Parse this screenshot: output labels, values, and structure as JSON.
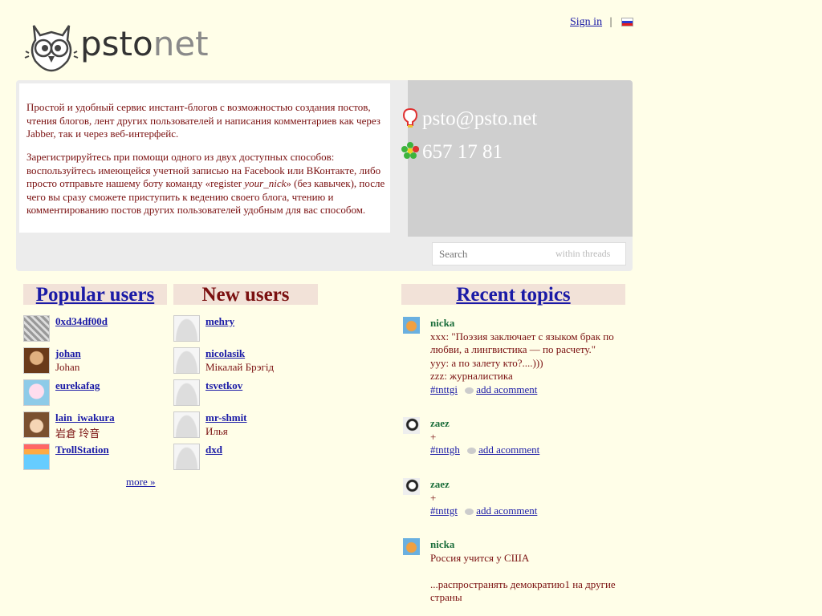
{
  "header": {
    "sign_in": "Sign in",
    "separator": "|",
    "logo_text_a": "psto",
    "logo_text_b": "net"
  },
  "intro": {
    "p1": "Простой и удобный сервис инстант-блогов с возможностью создания постов, чтения блогов, лент других пользователей и написания комментариев как через Jabber, так и через веб-интерфейс.",
    "p2_a": "Зарегистрируйтесь при помощи одного из двух доступных способов: воспользуйтесь имеющейся учетной записью на Facebook или ВКонтакте, либо просто отправьте нашему боту команду «register ",
    "p2_nick": "your_nick",
    "p2_b": "» (без кавычек), после чего вы сразу сможете приступить к ведению своего блога, чтению и комментированию постов других пользователей удобным для вас способом."
  },
  "contact": {
    "jabber": "psto@psto.net",
    "icq": "657 17 81"
  },
  "search": {
    "placeholder": "Search",
    "within": "within threads"
  },
  "columns": {
    "popular": "Popular users",
    "new": "New users",
    "recent": "Recent topics"
  },
  "popular_users": [
    {
      "nick": "0xd34df00d",
      "name": ""
    },
    {
      "nick": "johan",
      "name": "Johan"
    },
    {
      "nick": "eurekafag",
      "name": ""
    },
    {
      "nick": "lain_iwakura",
      "name": "岩倉 玲音"
    },
    {
      "nick": "TrollStation",
      "name": ""
    }
  ],
  "more": "more »",
  "new_users": [
    {
      "nick": "mehry",
      "name": ""
    },
    {
      "nick": "nicolasik",
      "name": "Мікалай Брэгід"
    },
    {
      "nick": "tsvetkov",
      "name": ""
    },
    {
      "nick": "mr-shmit",
      "name": "Илья"
    },
    {
      "nick": "dxd",
      "name": ""
    }
  ],
  "topics": [
    {
      "author": "nicka",
      "lines": [
        "xxx: \"Поэзия заключает с языком брак по любви, а лингвистика — по расчету.\"",
        "yyy: а по залету кто?....)))",
        "zzz: журналистика"
      ],
      "tag": "#tnttgi",
      "comment": "add acomment"
    },
    {
      "author": "zaez",
      "lines": [
        "+"
      ],
      "tag": "#tnttgh",
      "comment": "add acomment"
    },
    {
      "author": "zaez",
      "lines": [
        "+"
      ],
      "tag": "#tnttgt",
      "comment": "add acomment"
    },
    {
      "author": "nicka",
      "lines": [
        "Россия учится у США",
        "",
        "...распространять демократию1 на другие страны"
      ],
      "tag": "",
      "comment": ""
    }
  ]
}
